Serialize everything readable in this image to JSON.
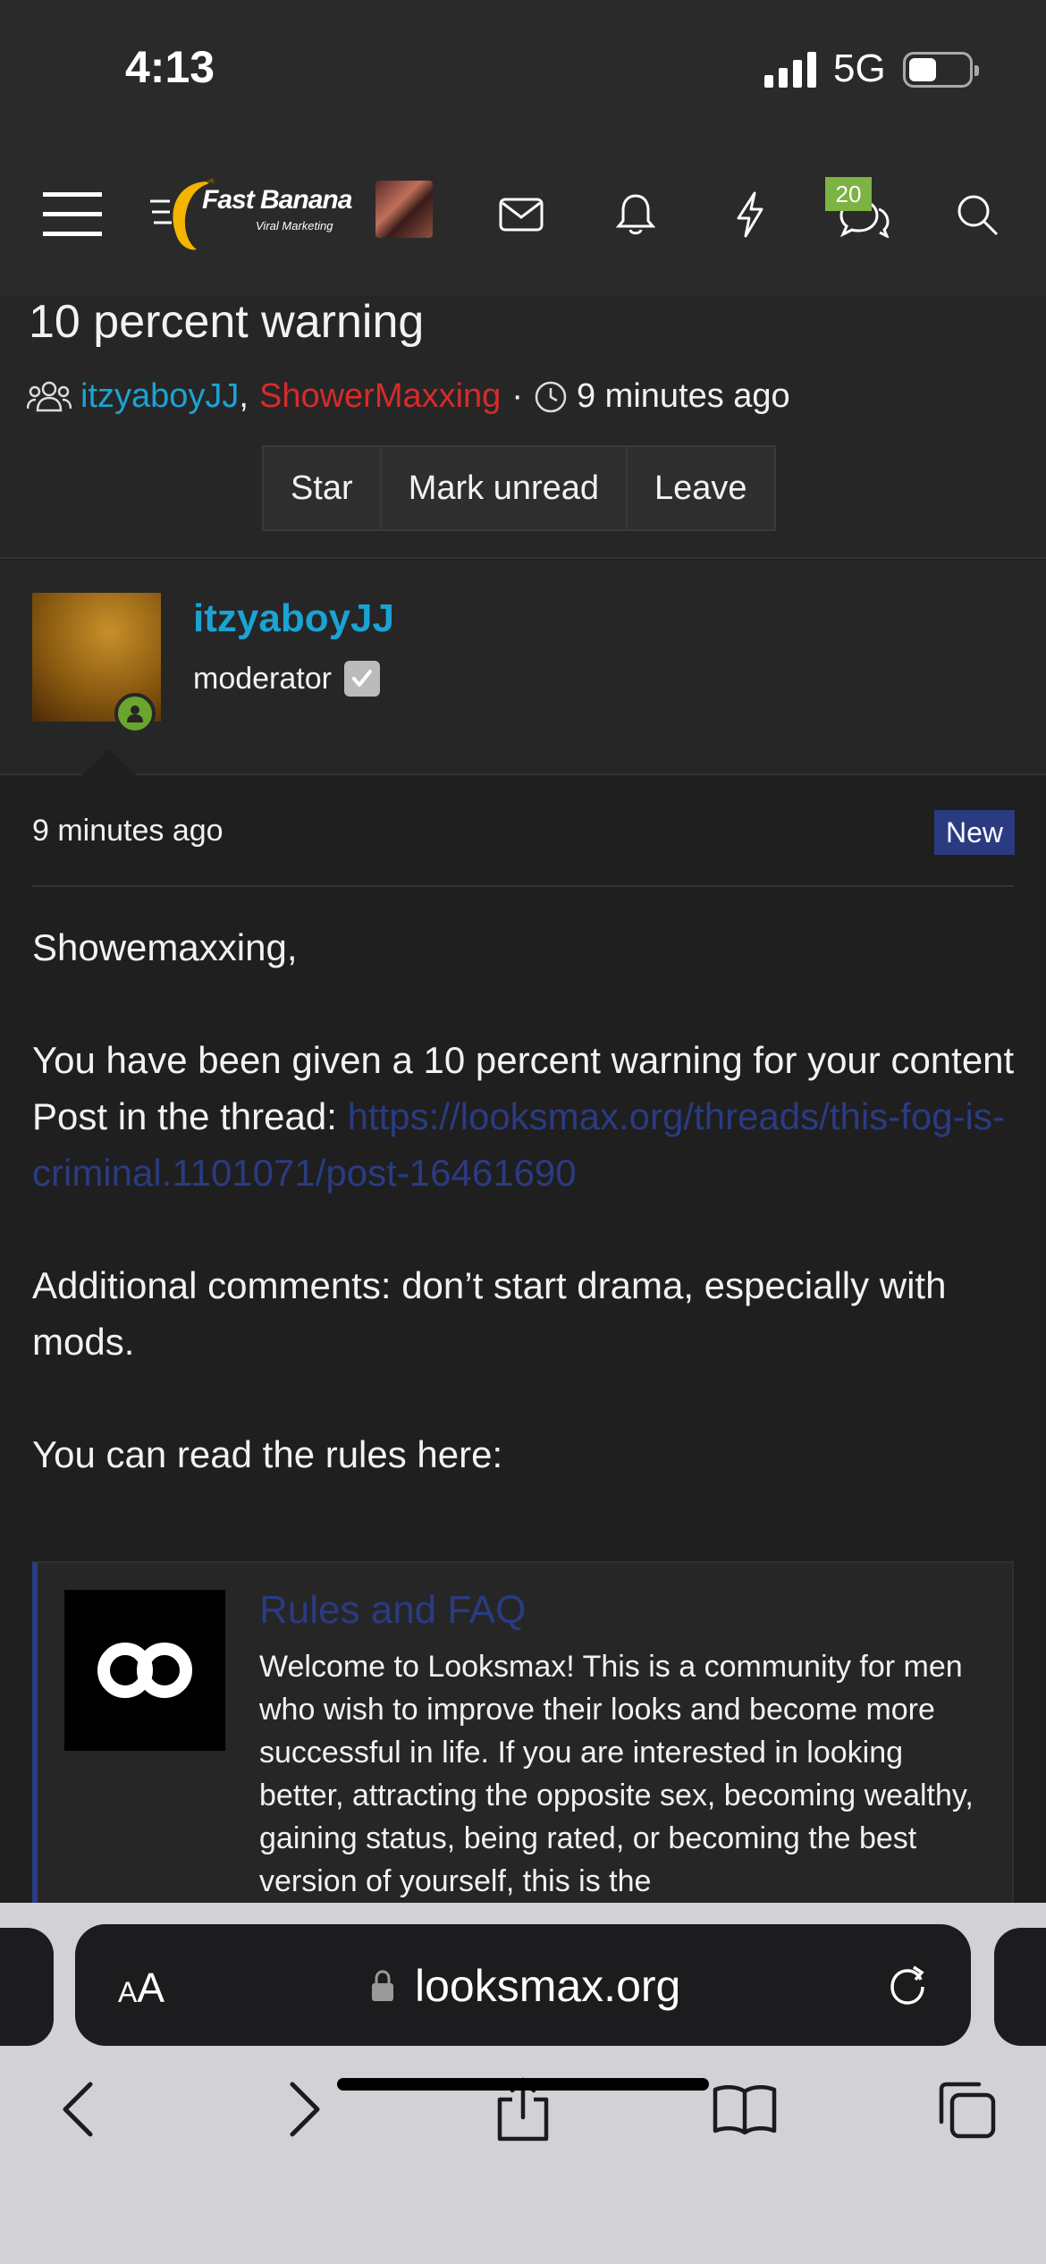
{
  "status_bar": {
    "time": "4:13",
    "network": "5G"
  },
  "nav": {
    "logo_name": "Fast Banana",
    "logo_tagline": "Viral Marketing",
    "conversations_badge": "20",
    "icons": [
      "menu-icon",
      "mail-icon",
      "bell-icon",
      "lightning-icon",
      "chat-bubbles-icon",
      "search-icon"
    ]
  },
  "conversation": {
    "title": "10 percent warning",
    "participant_1": "itzyaboyJJ",
    "separator": ",",
    "participant_2": "ShowerMaxxing",
    "dot": "·",
    "time": "9 minutes ago",
    "actions": {
      "star": "Star",
      "mark_unread": "Mark unread",
      "leave": "Leave"
    }
  },
  "message": {
    "author": "itzyaboyJJ",
    "role": "moderator",
    "time": "9 minutes ago",
    "badge": "New",
    "greeting": "Showemaxxing,",
    "line1": "You have been given a 10 percent warning for your content",
    "post_label": "Post in the thread: ",
    "post_link": "https://looksmax.org/threads/this-fog-is-criminal.1101071/post-16461690",
    "comments": "Additional comments: don’t start drama, especially with mods.",
    "rules_intro": "You can read the rules here:"
  },
  "unfurl": {
    "title": "Rules and FAQ",
    "description": "Welcome to Looksmax! This is a community for men who wish to improve their looks and become more successful in life. If you are interested in looking better, attracting the opposite sex, becoming wealthy, gaining status, being rated, or becoming the best version of yourself, this is the"
  },
  "browser": {
    "text_size_label_small": "A",
    "text_size_label_large": "A",
    "url": "looksmax.org"
  },
  "colors": {
    "username_blue": "#1ba3d4",
    "username_red": "#d62b2b",
    "link_navy": "#2b3b82",
    "online_green": "#6aa62e",
    "badge_green": "#7cb342"
  }
}
